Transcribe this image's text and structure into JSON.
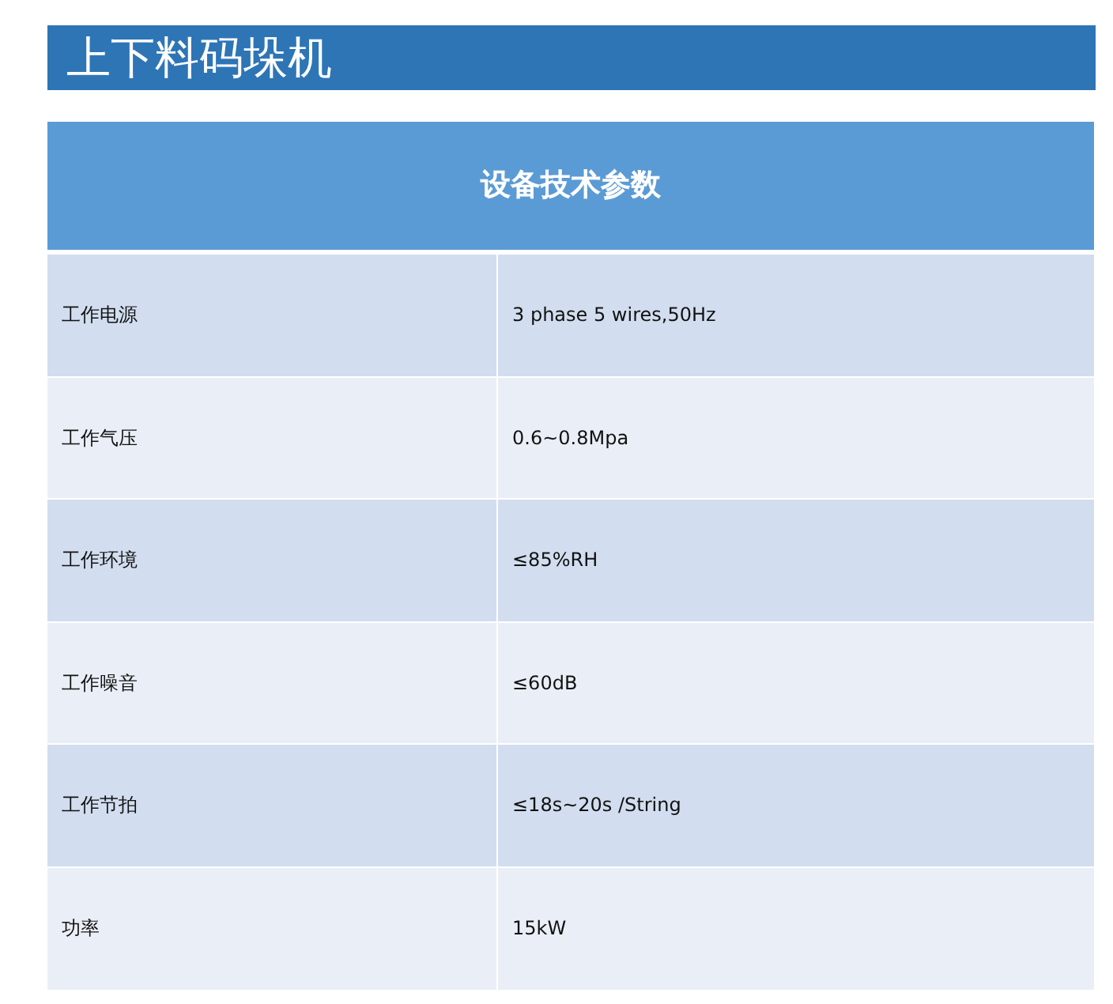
{
  "title": "上下料码垛机",
  "table": {
    "header": "设备技术参数",
    "rows": [
      {
        "label": "工作电源",
        "value": "3 phase 5 wires,50Hz"
      },
      {
        "label": "工作气压",
        "value": "0.6~0.8Mpa"
      },
      {
        "label": "工作环境",
        "value": "≤85%RH"
      },
      {
        "label": "工作噪音",
        "value": "≤60dB"
      },
      {
        "label": "工作节拍",
        "value": "≤18s~20s /String"
      },
      {
        "label": "功率",
        "value": "15kW"
      }
    ]
  }
}
